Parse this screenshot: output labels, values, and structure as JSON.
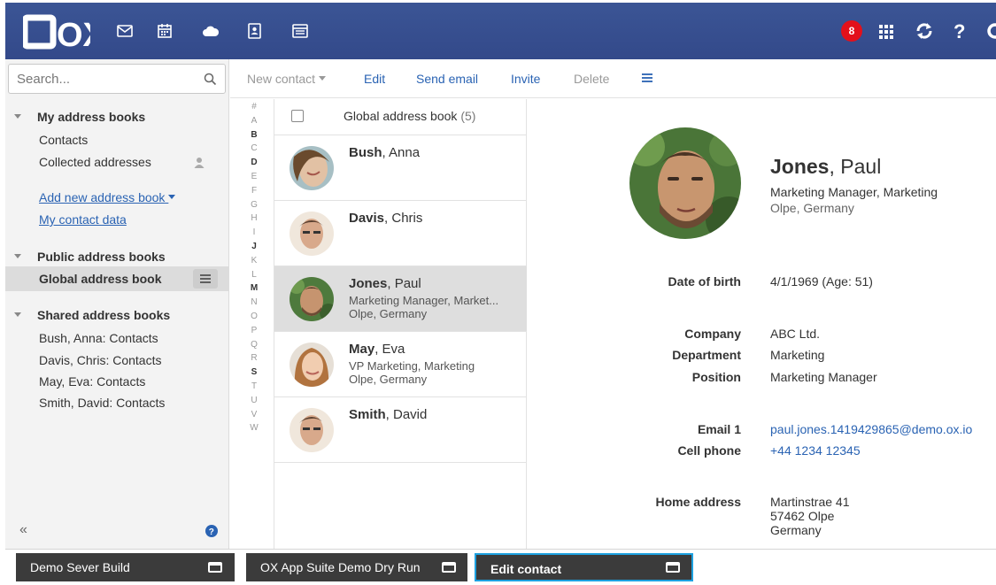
{
  "topbar": {
    "brand": "OX",
    "apps": [
      "mail-icon",
      "calendar-icon",
      "drive-icon",
      "address-book-icon",
      "portal-icon"
    ],
    "notification_count": "8",
    "right_icons": [
      "launcher-grid-icon",
      "refresh-icon",
      "help-icon",
      "settings-gear-icon"
    ],
    "colors": {
      "bar": "#3b5595",
      "badge": "#e3101b"
    }
  },
  "sidebar": {
    "search_placeholder": "Search...",
    "my_books": {
      "title": "My address books",
      "items": [
        "Contacts",
        "Collected addresses"
      ]
    },
    "add_new": "Add new address book",
    "my_contact_data": "My contact data",
    "public_books": {
      "title": "Public address books",
      "items": [
        "Global address book"
      ]
    },
    "shared_books": {
      "title": "Shared address books",
      "items": [
        "Bush, Anna: Contacts",
        "Davis, Chris: Contacts",
        "May, Eva: Contacts",
        "Smith, David: Contacts"
      ]
    },
    "collapse": "«"
  },
  "toolbar": {
    "new_contact": "New contact",
    "edit": "Edit",
    "send_email": "Send email",
    "invite": "Invite",
    "delete": "Delete"
  },
  "alphabet": [
    "#",
    "A",
    "B",
    "C",
    "D",
    "E",
    "F",
    "G",
    "H",
    "I",
    "J",
    "K",
    "L",
    "M",
    "N",
    "O",
    "P",
    "Q",
    "R",
    "S",
    "T",
    "U",
    "V",
    "W"
  ],
  "alphabet_strong": [
    "B",
    "D",
    "J",
    "M",
    "S"
  ],
  "list": {
    "title": "Global address book",
    "count": "(5)",
    "contacts": [
      {
        "last": "Bush",
        "first": ", Anna",
        "line1": "",
        "line2": ""
      },
      {
        "last": "Davis",
        "first": ", Chris",
        "line1": "",
        "line2": ""
      },
      {
        "last": "Jones",
        "first": ", Paul",
        "line1": "Marketing Manager, Market...",
        "line2": "Olpe, Germany"
      },
      {
        "last": "May",
        "first": ", Eva",
        "line1": "VP Marketing, Marketing",
        "line2": "Olpe, Germany"
      },
      {
        "last": "Smith",
        "first": ", David",
        "line1": "",
        "line2": ""
      }
    ]
  },
  "detail": {
    "last": "Jones",
    "first": ", Paul",
    "role": "Marketing Manager, Marketing",
    "location": "Olpe, Germany",
    "dob_label": "Date of birth",
    "dob_value": "4/1/1969 (Age: 51)",
    "company_label": "Company",
    "company_value": "ABC Ltd.",
    "department_label": "Department",
    "department_value": "Marketing",
    "position_label": "Position",
    "position_value": "Marketing Manager",
    "email_label": "Email 1",
    "email_value": "paul.jones.1419429865@demo.ox.io",
    "cell_label": "Cell phone",
    "cell_value": "+44 1234 12345",
    "home_label": "Home address",
    "home_lines": [
      "Martinstrae 41",
      "57462 Olpe",
      "Germany"
    ]
  },
  "taskbar": [
    {
      "label": "Demo Sever Build",
      "active": false
    },
    {
      "label": "OX App Suite Demo Dry Run",
      "active": false
    },
    {
      "label": "Edit contact",
      "active": true
    }
  ]
}
